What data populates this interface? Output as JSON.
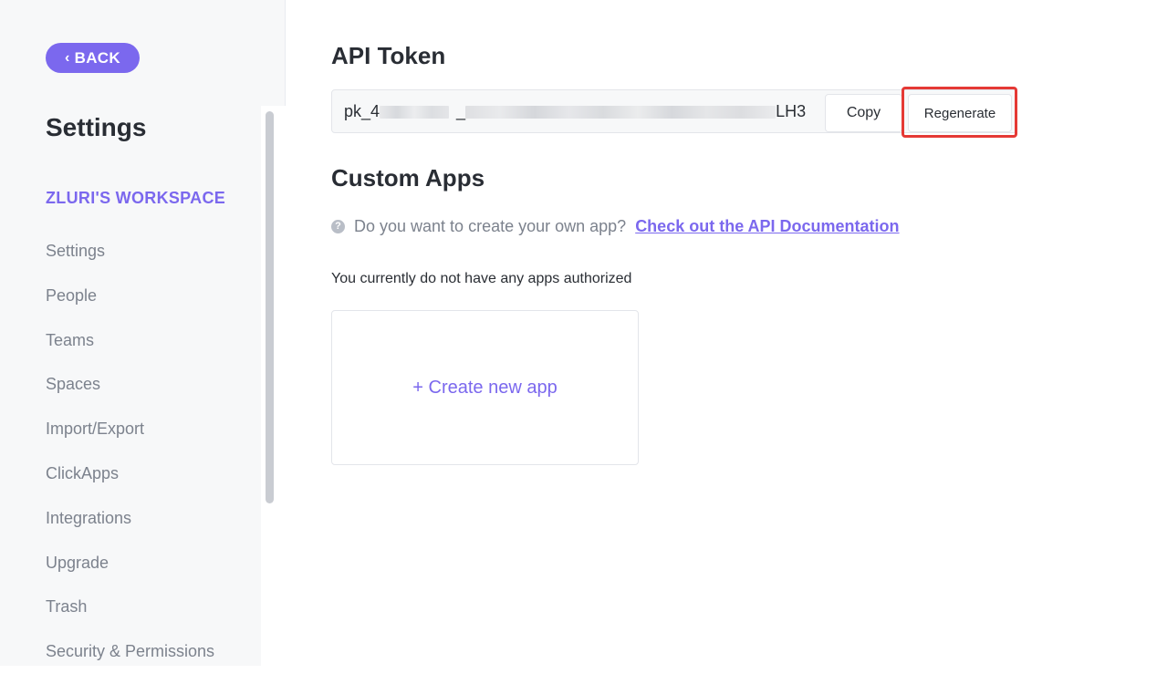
{
  "sidebar": {
    "back_label": "BACK",
    "title": "Settings",
    "workspace": "ZLURI'S WORKSPACE",
    "items": [
      {
        "label": "Settings"
      },
      {
        "label": "People"
      },
      {
        "label": "Teams"
      },
      {
        "label": "Spaces"
      },
      {
        "label": "Import/Export"
      },
      {
        "label": "ClickApps"
      },
      {
        "label": "Integrations"
      },
      {
        "label": "Upgrade"
      },
      {
        "label": "Trash"
      },
      {
        "label": "Security & Permissions"
      }
    ]
  },
  "api_token": {
    "heading": "API Token",
    "token_prefix": "pk_4",
    "token_mid": "_",
    "token_suffix": "LH3",
    "copy_label": "Copy",
    "regenerate_label": "Regenerate"
  },
  "custom_apps": {
    "heading": "Custom Apps",
    "help_text": "Do you want to create your own app?",
    "doc_link": "Check out the API Documentation",
    "empty_text": "You currently do not have any apps authorized",
    "create_label": "+ Create new app"
  },
  "colors": {
    "accent": "#7b68ee",
    "highlight": "#e53935"
  },
  "icons": {
    "back": "chevron-left-icon",
    "help": "question-circle-icon"
  }
}
